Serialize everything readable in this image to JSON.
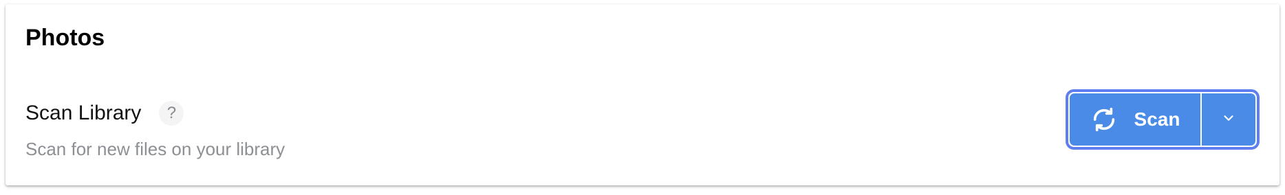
{
  "card": {
    "title": "Photos"
  },
  "setting": {
    "label": "Scan Library",
    "help_glyph": "?",
    "description": "Scan for new files on your library"
  },
  "actions": {
    "scan_label": "Scan",
    "scan_icon": "refresh-icon",
    "dropdown_icon": "chevron-down-icon"
  },
  "colors": {
    "button_bg": "#4a8be8",
    "focus_ring": "#5f7ff0",
    "description_text": "#8c8f94"
  }
}
